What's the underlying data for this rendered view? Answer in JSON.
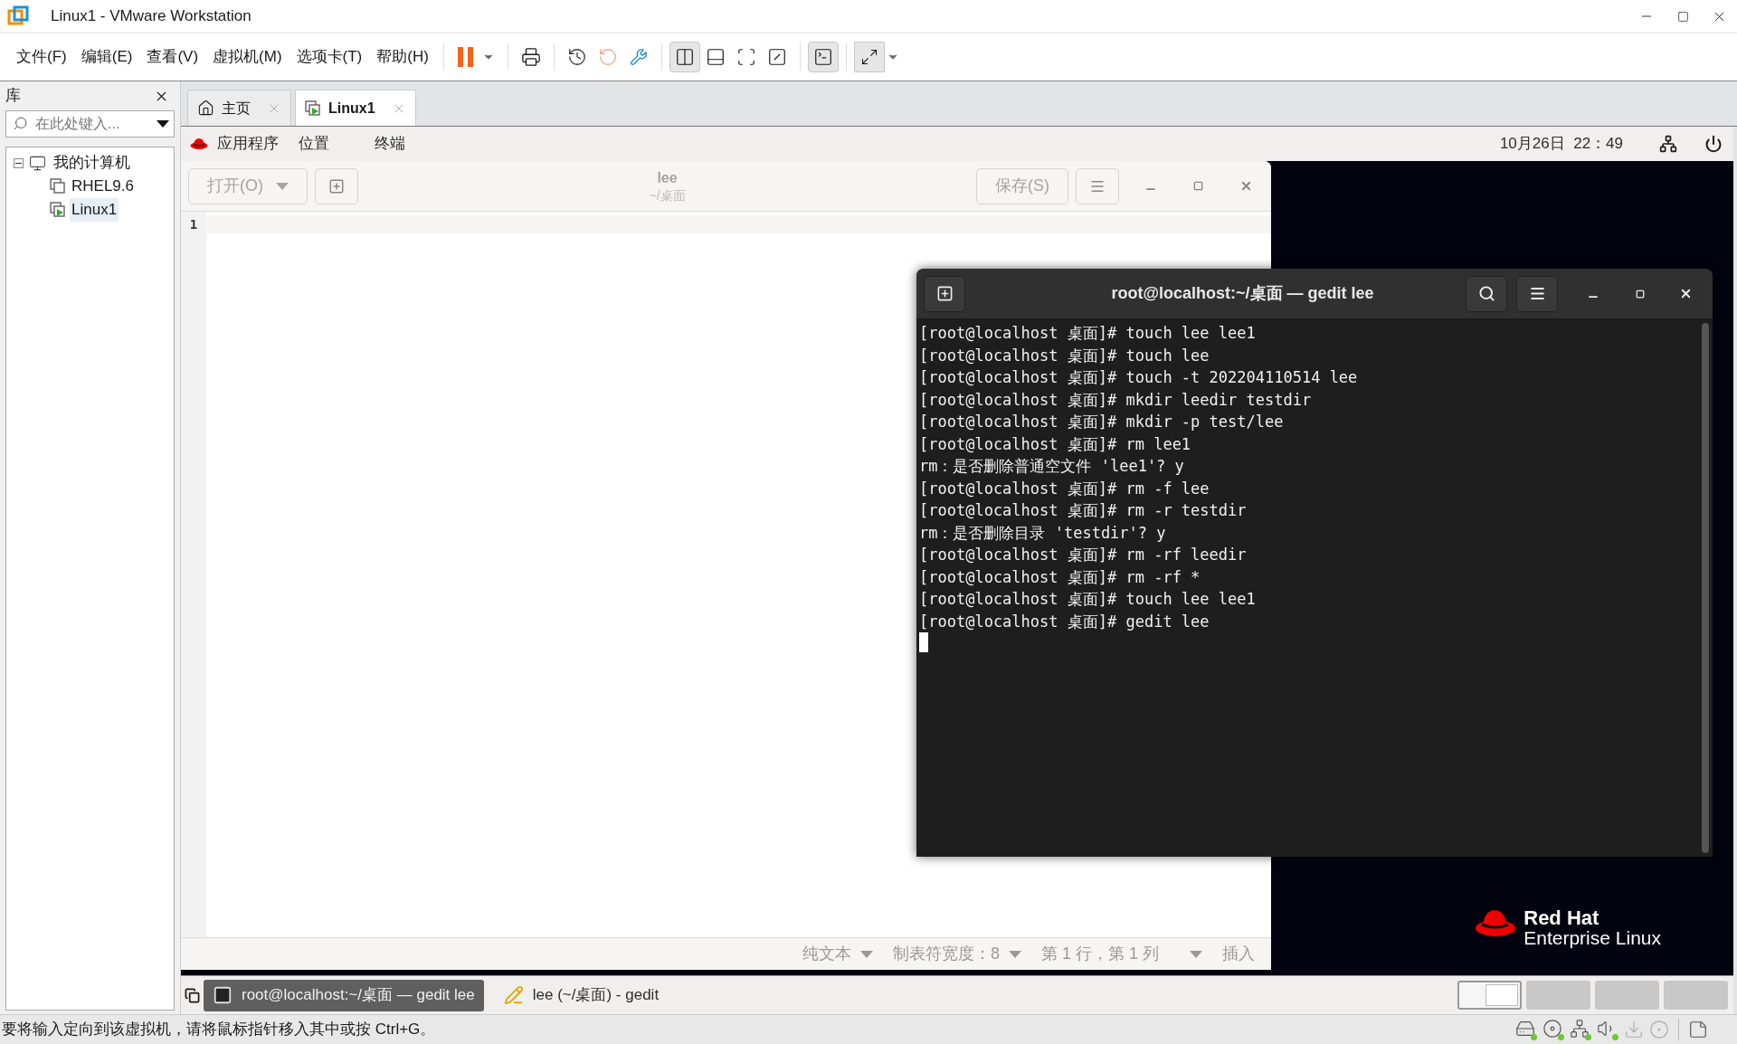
{
  "window": {
    "title": "Linux1 - VMware Workstation"
  },
  "menu": [
    "文件(F)",
    "编辑(E)",
    "查看(V)",
    "虚拟机(M)",
    "选项卡(T)",
    "帮助(H)"
  ],
  "library": {
    "title": "库",
    "search": {
      "placeholder": "在此处键入..."
    },
    "tree": [
      {
        "label": "我的计算机",
        "expanded": true,
        "selected": false,
        "children": [
          {
            "label": "RHEL9.6",
            "selected": false,
            "running": false
          },
          {
            "label": "Linux1",
            "selected": true,
            "running": true
          }
        ]
      }
    ]
  },
  "tabs": [
    {
      "label": "主页",
      "kind": "home",
      "selected": false
    },
    {
      "label": "Linux1",
      "kind": "vm",
      "selected": true
    }
  ],
  "guest": {
    "top_bar": {
      "menus": [
        "应用程序",
        "位置",
        "终端"
      ],
      "clock": "10月26日  22：49"
    },
    "gedit": {
      "title": "lee",
      "subtitle": "~/桌面",
      "open_button": "打开(O)",
      "save_button": "保存(S)",
      "line_numbers": [
        "1"
      ],
      "status": [
        {
          "label": "纯文本",
          "kind": "dropdown"
        },
        {
          "label": "制表符宽度：8",
          "kind": "dropdown"
        },
        {
          "label": "第 1 行，第 1 列",
          "kind": "dropdown"
        },
        {
          "label": "插入",
          "kind": "text"
        }
      ]
    },
    "terminal": {
      "title": "root@localhost:~/桌面 — gedit lee",
      "lines": [
        "[root@localhost 桌面]# touch lee lee1",
        "[root@localhost 桌面]# touch lee",
        "[root@localhost 桌面]# touch -t 202204110514 lee",
        "[root@localhost 桌面]# mkdir leedir testdir",
        "[root@localhost 桌面]# mkdir -p test/lee",
        "[root@localhost 桌面]# rm lee1",
        "rm：是否删除普通空文件 'lee1'? y",
        "[root@localhost 桌面]# rm -f lee",
        "[root@localhost 桌面]# rm -r testdir",
        "rm：是否删除目录 'testdir'? y",
        "[root@localhost 桌面]# rm -rf leedir",
        "[root@localhost 桌面]# rm -rf *",
        "[root@localhost 桌面]# touch lee lee1",
        "[root@localhost 桌面]# gedit lee"
      ]
    },
    "branding": {
      "line_1": "Red Hat",
      "line_2": "Enterprise Linux"
    },
    "taskbar": [
      {
        "label": "root@localhost:~/桌面 — gedit lee",
        "kind": "terminal",
        "selected": true
      },
      {
        "label": "lee (~/桌面) - gedit",
        "kind": "editor",
        "selected": false
      }
    ],
    "workspaces": [
      {
        "selected": true
      },
      {
        "selected": false
      },
      {
        "selected": false
      },
      {
        "selected": false
      }
    ]
  },
  "status_bar": {
    "message": "要将输入定向到该虚拟机，请将鼠标指针移入其中或按 Ctrl+G。"
  }
}
